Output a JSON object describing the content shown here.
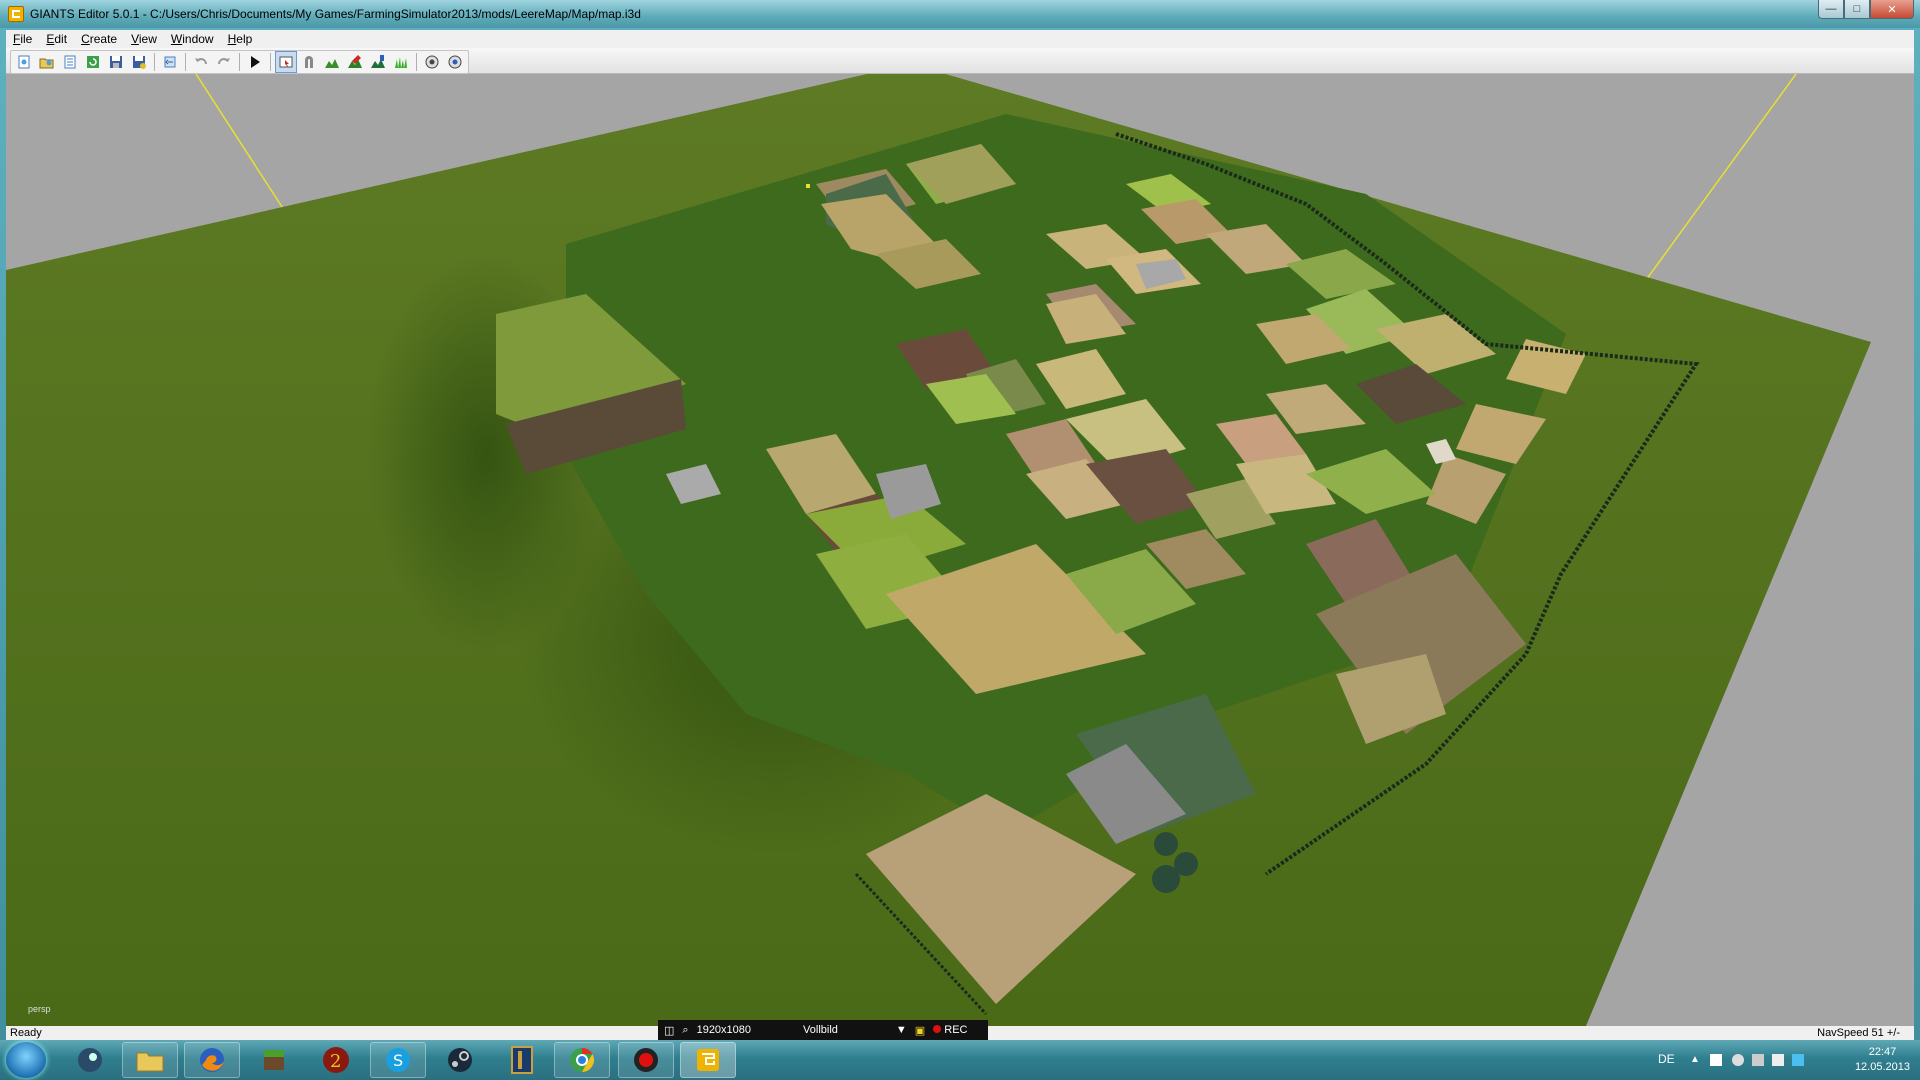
{
  "window": {
    "title": "GIANTS Editor 5.0.1 - C:/Users/Chris/Documents/My Games/FarmingSimulator2013/mods/LeereMap/Map/map.i3d",
    "controls": [
      "minimize",
      "maximize",
      "close"
    ]
  },
  "menu": {
    "items": [
      {
        "label": "File",
        "key": "F"
      },
      {
        "label": "Edit",
        "key": "E"
      },
      {
        "label": "Create",
        "key": "C"
      },
      {
        "label": "View",
        "key": "V"
      },
      {
        "label": "Window",
        "key": "W"
      },
      {
        "label": "Help",
        "key": "H"
      }
    ]
  },
  "toolbar": {
    "buttons": [
      "new-icon",
      "open-icon",
      "import-icon",
      "reload-icon",
      "save-icon",
      "save-all-icon",
      "reset-icon",
      "undo-icon",
      "redo-icon",
      "play-icon",
      "select-mode-icon",
      "move-mode-icon",
      "terrain-sculpt-icon",
      "terrain-paint-icon",
      "foliage-paint-icon",
      "grass-paint-icon",
      "shader-icon",
      "shader-alt-icon"
    ]
  },
  "viewport": {
    "camera_label": "persp"
  },
  "status": {
    "left": "Ready",
    "right": "NavSpeed 51 +/-"
  },
  "recorder": {
    "resolution": "1920x1080",
    "mode": "Vollbild",
    "rec_label": "REC"
  },
  "taskbar": {
    "apps": [
      "steam-like-icon",
      "explorer-icon",
      "firefox-icon",
      "minecraft-icon",
      "guild-wars-2-icon",
      "skype-icon",
      "steam-icon",
      "league-icon",
      "chrome-icon",
      "recorder-icon",
      "giants-editor-icon"
    ],
    "language": "DE",
    "time": "22:47",
    "date": "12.05.2013"
  },
  "colors": {
    "taskbar": "#2f7f8f",
    "viewport_bg": "#a5a5a5",
    "terrain": "#55701c"
  }
}
